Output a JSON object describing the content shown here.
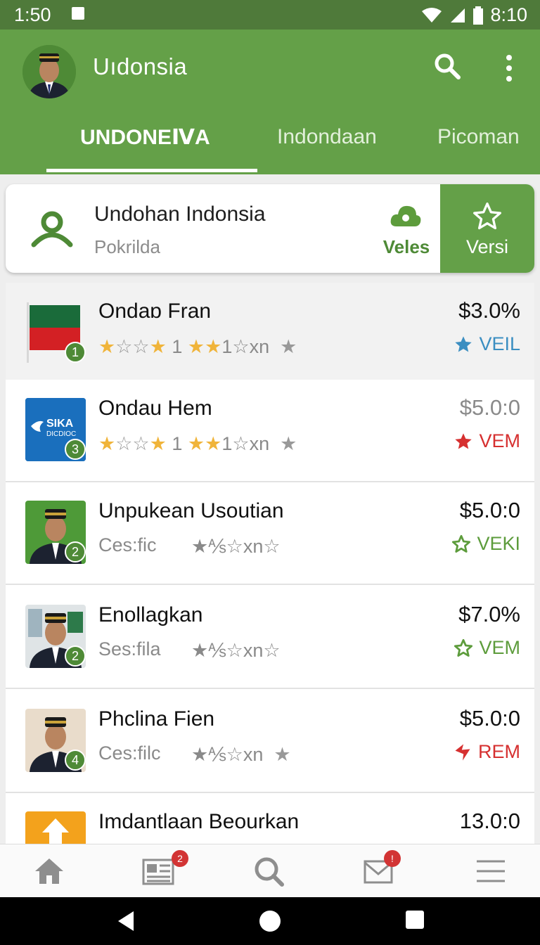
{
  "status_bar": {
    "time": "1:50",
    "right_text": "8:10"
  },
  "app_bar": {
    "title": "Uıdonsia"
  },
  "tabs": [
    {
      "label": "UNDONEⅣA",
      "active": true
    },
    {
      "label": "Indondaan",
      "active": false
    },
    {
      "label": "Picoman",
      "active": false
    }
  ],
  "header_card": {
    "title": "Undohan Indonsia",
    "subtitle": "Pokrilda",
    "cloud_label": "Veles",
    "star_label": "Versi"
  },
  "list_items": [
    {
      "title": "Ondaɒ Fran",
      "badge": "1",
      "stars_text": "1",
      "stars_text2": "1☆xn",
      "price": "$3.0%",
      "status": "VEIL",
      "status_color": "#3b8ec1"
    },
    {
      "title": "Ondau Hem",
      "badge": "3",
      "stars_text": "1",
      "stars_text2": "1☆xn",
      "price": "$5.0:0",
      "status": "VEM",
      "status_color": "#d63030"
    },
    {
      "title": "Unpukean Usoutian",
      "badge": "2",
      "meta": "Ces:fic",
      "stars_text2": "★⅍☆xn☆",
      "price": "$5.0:0",
      "status": "VEKI",
      "status_color": "#5d9c3c"
    },
    {
      "title": "Enollagkan",
      "badge": "2",
      "meta": "Ses:fila",
      "stars_text2": "★⅍☆xn☆",
      "price": "$7.0%",
      "status": "VEM",
      "status_color": "#5d9c3c"
    },
    {
      "title": "Phclina Fien",
      "badge": "4",
      "meta": "Ces:filc",
      "stars_text2": "★⅍☆xn",
      "price": "$5.0:0",
      "status": "REM",
      "status_color": "#d63030"
    },
    {
      "title": "Imdantlaan Beourkan",
      "price": "13.0:0"
    }
  ],
  "thumb_text": {
    "sika": "SIKA",
    "sika_sub": "DICDIOC"
  },
  "bottom_nav": {
    "items": [
      "home-icon",
      "news-icon",
      "search-icon",
      "mail-icon",
      "menu-icon"
    ],
    "news_badge": "2",
    "mail_badge": "!"
  },
  "colors": {
    "primary": "#64a048",
    "primary_dark": "#4f7a3a",
    "accent_green": "#4e8a36"
  }
}
